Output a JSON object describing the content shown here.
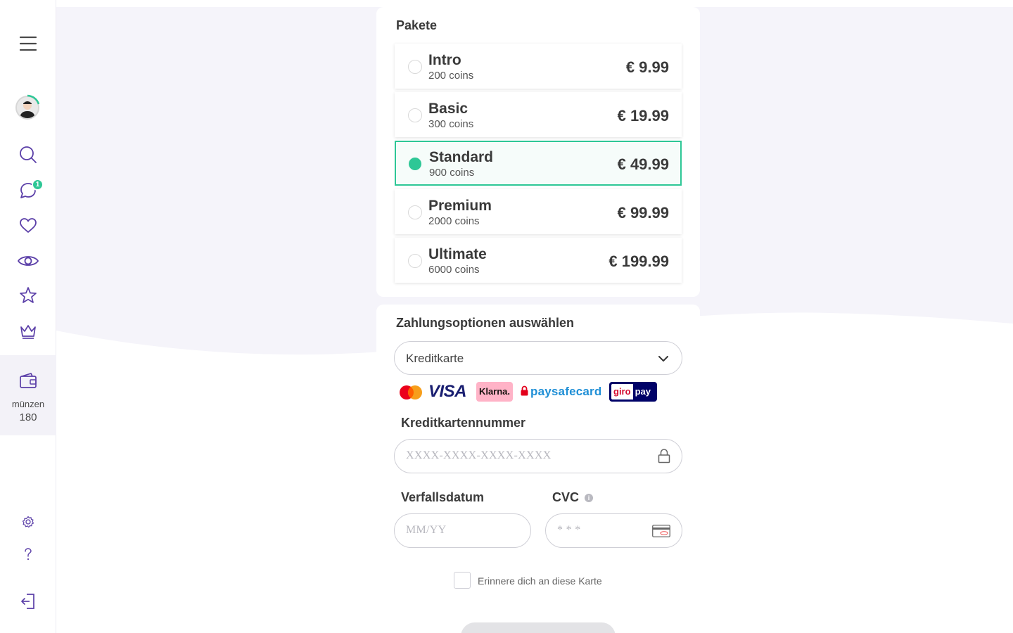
{
  "sidebar": {
    "menu_icon": "hamburger-menu-icon",
    "chat_badge": "1",
    "wallet": {
      "label": "münzen",
      "value": "180"
    }
  },
  "packages": {
    "title": "Pakete",
    "items": [
      {
        "name": "Intro",
        "coins": "200 coins",
        "price": "€ 9.99",
        "selected": false
      },
      {
        "name": "Basic",
        "coins": "300 coins",
        "price": "€ 19.99",
        "selected": false
      },
      {
        "name": "Standard",
        "coins": "900 coins",
        "price": "€ 49.99",
        "selected": true
      },
      {
        "name": "Premium",
        "coins": "2000 coins",
        "price": "€ 99.99",
        "selected": false
      },
      {
        "name": "Ultimate",
        "coins": "6000 coins",
        "price": "€ 199.99",
        "selected": false
      }
    ]
  },
  "payment": {
    "title": "Zahlungsoptionen auswählen",
    "method_selected": "Kreditkarte",
    "logos": {
      "mastercard": "mastercard-logo",
      "visa": "VISA",
      "klarna": "Klarna.",
      "paysafecard": "paysafecard",
      "giropay": {
        "giro": "giro",
        "pay": "pay"
      }
    },
    "card_number": {
      "label": "Kreditkartennummer",
      "placeholder": "XXXX-XXXX-XXXX-XXXX"
    },
    "expiry": {
      "label": "Verfallsdatum",
      "placeholder": "MM/YY"
    },
    "cvc": {
      "label": "CVC",
      "placeholder": "* * *",
      "info": "i"
    },
    "remember_label": "Erinnere dich an diese Karte"
  },
  "colors": {
    "accent": "#2ec796",
    "icon": "#5b3fa8",
    "text": "#3a3a3a"
  }
}
